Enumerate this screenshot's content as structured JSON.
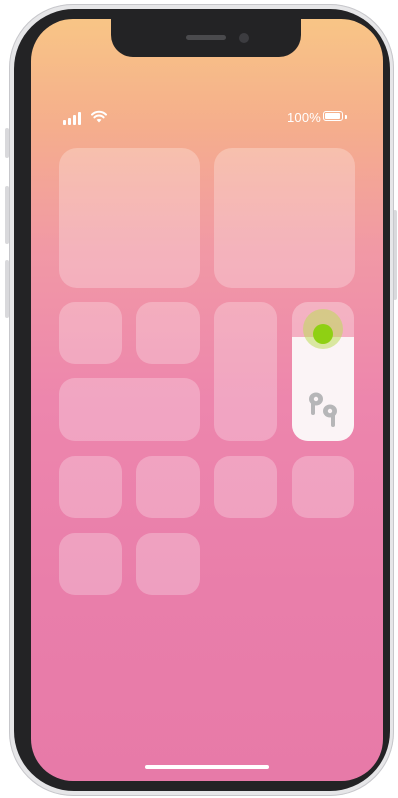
{
  "status_bar": {
    "battery_text": "100%",
    "battery_level": 1.0,
    "signal_icon": "cellular-signal-icon",
    "wifi_icon": "wifi-icon"
  },
  "control_center": {
    "volume_level": 0.75,
    "volume_icon": "airpods-icon"
  },
  "touch_indicator": {
    "color": "#8fd013"
  }
}
